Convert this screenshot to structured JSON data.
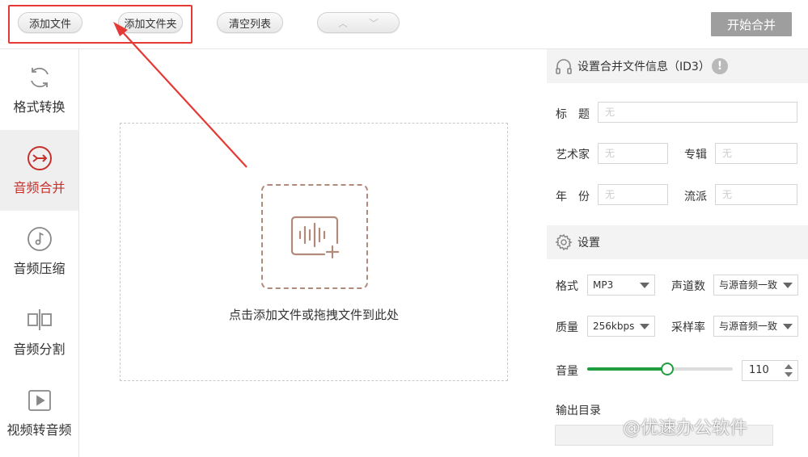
{
  "toolbar": {
    "add_file": "添加文件",
    "add_folder": "添加文件夹",
    "clear_list": "清空列表",
    "move_up_icon": "chevron-up-icon",
    "move_down_icon": "chevron-down-icon",
    "start_merge": "开始合并"
  },
  "sidebar": {
    "items": [
      {
        "label": "格式转换",
        "icon": "refresh-icon",
        "active": false
      },
      {
        "label": "音频合并",
        "icon": "merge-icon",
        "active": true
      },
      {
        "label": "音频压缩",
        "icon": "music-note-icon",
        "active": false
      },
      {
        "label": "音频分割",
        "icon": "split-icon",
        "active": false
      },
      {
        "label": "视频转音频",
        "icon": "play-icon",
        "active": false
      }
    ]
  },
  "main": {
    "drop_hint": "点击添加文件或拖拽文件到此处",
    "drop_icon": "audio-add-icon"
  },
  "id3": {
    "title": "设置合并文件信息（ID3）",
    "fields": {
      "title_label": "标　题",
      "artist_label": "艺术家",
      "album_label": "专辑",
      "year_label": "年　份",
      "genre_label": "流派",
      "placeholder": "无"
    }
  },
  "settings": {
    "title": "设置",
    "format_label": "格式",
    "format_value": "MP3",
    "channels_label": "声道数",
    "channels_value": "与源音频一致",
    "quality_label": "质量",
    "quality_value": "256kbps",
    "samplerate_label": "采样率",
    "samplerate_value": "与源音频一致",
    "volume_label": "音量",
    "volume_value": "110",
    "volume_fraction": 0.55,
    "output_label": "输出目录"
  },
  "watermark": "@优速办公软件",
  "colors": {
    "accent_red": "#c6312c",
    "slider_green": "#1e9e3f",
    "highlight_red": "#e53935"
  }
}
